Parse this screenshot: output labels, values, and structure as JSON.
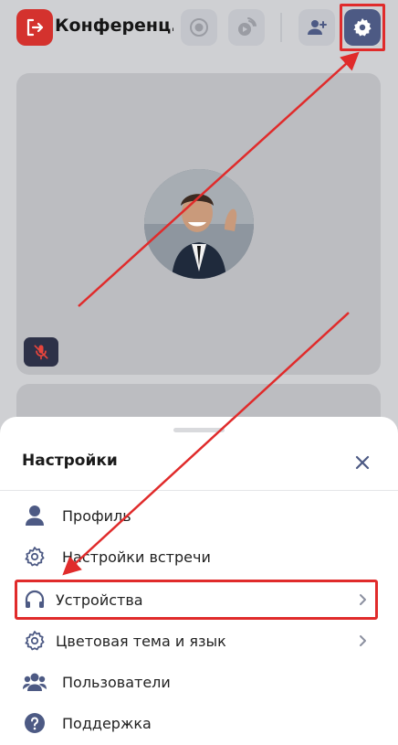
{
  "header": {
    "title": "Конференц..."
  },
  "settings_sheet": {
    "title": "Настройки",
    "items": [
      {
        "label": "Профиль",
        "icon": "user-icon",
        "has_chevron": false
      },
      {
        "label": "Настройки встречи",
        "icon": "gear-icon",
        "has_chevron": false
      },
      {
        "label": "Устройства",
        "icon": "headphones-icon",
        "has_chevron": true
      },
      {
        "label": "Цветовая тема и язык",
        "icon": "gear-icon",
        "has_chevron": true
      },
      {
        "label": "Пользователи",
        "icon": "users-icon",
        "has_chevron": false
      },
      {
        "label": "Поддержка",
        "icon": "help-icon",
        "has_chevron": false
      }
    ]
  },
  "colors": {
    "accent": "#4d5a84",
    "exit": "#d4322e",
    "highlight": "#e02b2b",
    "icon": "#4d5a84"
  }
}
